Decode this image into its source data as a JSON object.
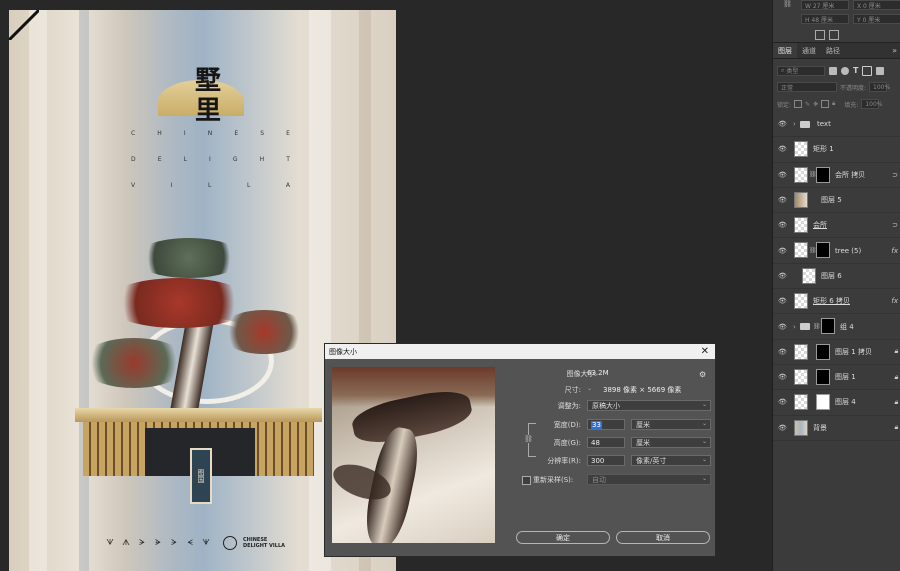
{
  "poster": {
    "title_line1": "墅",
    "title_line2": "里",
    "subtitle_rows": [
      [
        "C",
        "H",
        "I",
        "N",
        "E",
        "S",
        "E"
      ],
      [
        "D",
        "E",
        "L",
        "I",
        "G",
        "H",
        "T"
      ],
      [
        "V",
        "I",
        "L",
        "L",
        "A"
      ]
    ],
    "sign_text": "图国",
    "footer_icons": [
      "ᗐ",
      "ᗑ",
      "ᗒ",
      "ᗓ",
      "ᗔ",
      "ᗕ",
      "ᗖ"
    ],
    "footer_logo_line1": "CHINESE",
    "footer_logo_line2": "DELIGHT VILLA"
  },
  "properties": {
    "w_value": "W  27 厘米",
    "x_value": "X  0 厘米",
    "h_value": "H  48 厘米",
    "y_value": "Y  0 厘米"
  },
  "layers_panel": {
    "tabs": [
      "图层",
      "通道",
      "路径"
    ],
    "filter_placeholder": "类型",
    "blend_mode": "正常",
    "opacity_label": "不透明度:",
    "opacity_value": "100%",
    "lock_label": "锁定:",
    "fill_label": "填充:",
    "fill_value": "100%",
    "layers": [
      {
        "name": "text",
        "type": "group"
      },
      {
        "name": "矩形 1",
        "type": "shape"
      },
      {
        "name": "会所 拷贝",
        "type": "masked"
      },
      {
        "name": "图层 5",
        "type": "image"
      },
      {
        "name": "会所",
        "type": "smart"
      },
      {
        "name": "tree (5)",
        "type": "masked"
      },
      {
        "name": "图层 6",
        "type": "pixel"
      },
      {
        "name": "矩形 6 拷贝",
        "type": "shape"
      },
      {
        "name": "组 4",
        "type": "group-masked"
      },
      {
        "name": "图层 1 拷贝",
        "type": "masked"
      },
      {
        "name": "图层 1",
        "type": "masked"
      },
      {
        "name": "图层 4",
        "type": "masked"
      },
      {
        "name": "背景",
        "type": "background"
      }
    ]
  },
  "dialog": {
    "title": "图像大小",
    "image_size_label": "图像大小:",
    "image_size_value": "63.2M",
    "dimensions_label": "尺寸:",
    "dimensions_value": "3898 像素  ×  5669 像素",
    "fit_label": "调整为:",
    "fit_value": "原稿大小",
    "width_label": "宽度(D):",
    "width_value": "33",
    "width_unit": "厘米",
    "height_label": "高度(G):",
    "height_value": "48",
    "height_unit": "厘米",
    "resolution_label": "分辨率(R):",
    "resolution_value": "300",
    "resolution_unit": "像素/英寸",
    "resample_label": "重新采样(S):",
    "resample_value": "自动",
    "ok_label": "确定",
    "cancel_label": "取消"
  }
}
